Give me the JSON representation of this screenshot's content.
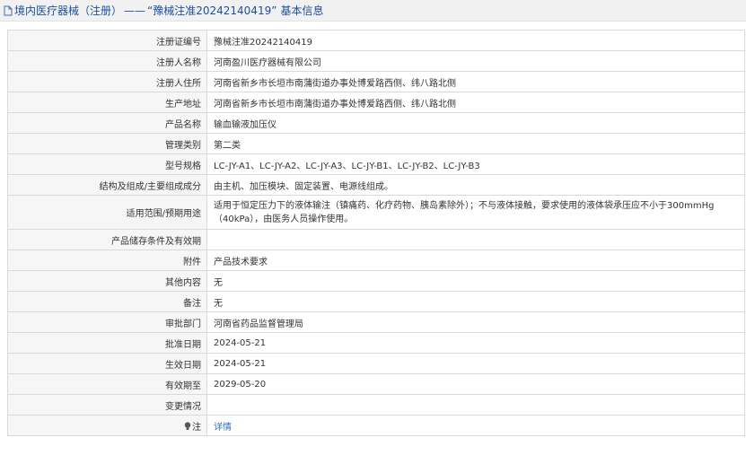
{
  "header": {
    "category": "境内医疗器械（注册）",
    "separator": "——",
    "registration_no_quoted": "“豫械注准20242140419”",
    "section": "基本信息"
  },
  "rows": [
    {
      "label": "注册证编号",
      "value": "豫械注准20242140419"
    },
    {
      "label": "注册人名称",
      "value": "河南盈川医疗器械有限公司"
    },
    {
      "label": "注册人住所",
      "value": "河南省新乡市长垣市南蒲街道办事处博爱路西侧、纬八路北侧"
    },
    {
      "label": "生产地址",
      "value": "河南省新乡市长垣市南蒲街道办事处博爱路西侧、纬八路北侧"
    },
    {
      "label": "产品名称",
      "value": "输血输液加压仪"
    },
    {
      "label": "管理类别",
      "value": "第二类"
    },
    {
      "label": "型号规格",
      "value": "LC-JY-A1、LC-JY-A2、LC-JY-A3、LC-JY-B1、LC-JY-B2、LC-JY-B3"
    },
    {
      "label": "结构及组成/主要组成成分",
      "value": "由主机、加压模块、固定装置、电源线组成。"
    },
    {
      "label": "适用范围/预期用途",
      "value": "适用于恒定压力下的液体输注（镇痛药、化疗药物、胰岛素除外）；不与液体接触，要求使用的液体袋承压应不小于300mmHg（40kPa），由医务人员操作使用。"
    },
    {
      "label": "产品储存条件及有效期",
      "value": ""
    },
    {
      "label": "附件",
      "value": "产品技术要求"
    },
    {
      "label": "其他内容",
      "value": "无"
    },
    {
      "label": "备注",
      "value": "无"
    },
    {
      "label": "审批部门",
      "value": "河南省药品监督管理局"
    },
    {
      "label": "批准日期",
      "value": "2024-05-21"
    },
    {
      "label": "生效日期",
      "value": "2024-05-21"
    },
    {
      "label": "有效期至",
      "value": "2029-05-20"
    },
    {
      "label": "变更情况",
      "value": ""
    },
    {
      "label": "注",
      "value": "详情"
    }
  ]
}
